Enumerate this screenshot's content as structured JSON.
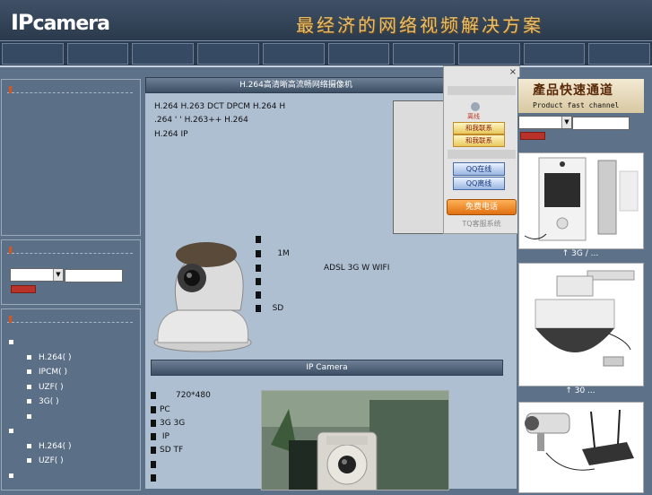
{
  "header": {
    "logo_ip": "IP",
    "logo_rest": "camera",
    "slogan": "最经济的网络视频解决方案"
  },
  "main": {
    "title1": "H.264高清晰高流畅网络摄像机",
    "intro": [
      "H.264 H.263      DCT     DPCM                H.264                              H",
      ".264                  '   '    H.263++                  H.264",
      "   H.264                        IP"
    ],
    "features1": [
      "",
      "1M",
      "ADSL 3G        W     WIFI",
      "",
      "",
      "SD"
    ],
    "title2": "IP Camera",
    "features2": [
      "720*480",
      "PC",
      "3G       3G",
      "         IP",
      "SD  TF",
      "",
      ""
    ]
  },
  "tq": {
    "close": "×",
    "offline": "离线",
    "contact1": "和我联系",
    "contact2": "和我联系",
    "qq_online": "QQ在线",
    "qq_offline": "QQ离线",
    "phone": "免费电话",
    "footer": "TQ客服系统"
  },
  "right": {
    "title": "產品快速通道",
    "subtitle": "Product fast channel",
    "captions": [
      "↑  3G   /  ...",
      "↑ 30        ...",
      ""
    ]
  },
  "left": {
    "tree": [
      {
        "type": "group",
        "label": ""
      },
      {
        "type": "item",
        "label": "H.264(  )"
      },
      {
        "type": "item",
        "label": "IPCM(  )"
      },
      {
        "type": "item",
        "label": "UZF(  )"
      },
      {
        "type": "item",
        "label": "3G(    )"
      },
      {
        "type": "item",
        "label": ""
      },
      {
        "type": "group",
        "label": ""
      },
      {
        "type": "item",
        "label": "H.264(  )"
      },
      {
        "type": "item",
        "label": "UZF(  )"
      },
      {
        "type": "group",
        "label": ""
      }
    ]
  },
  "colors": {
    "accent_orange": "#d9541f",
    "header_bg": "#2b3a4c",
    "main_bg": "#aebfd2",
    "slogan": "#e3c070"
  }
}
